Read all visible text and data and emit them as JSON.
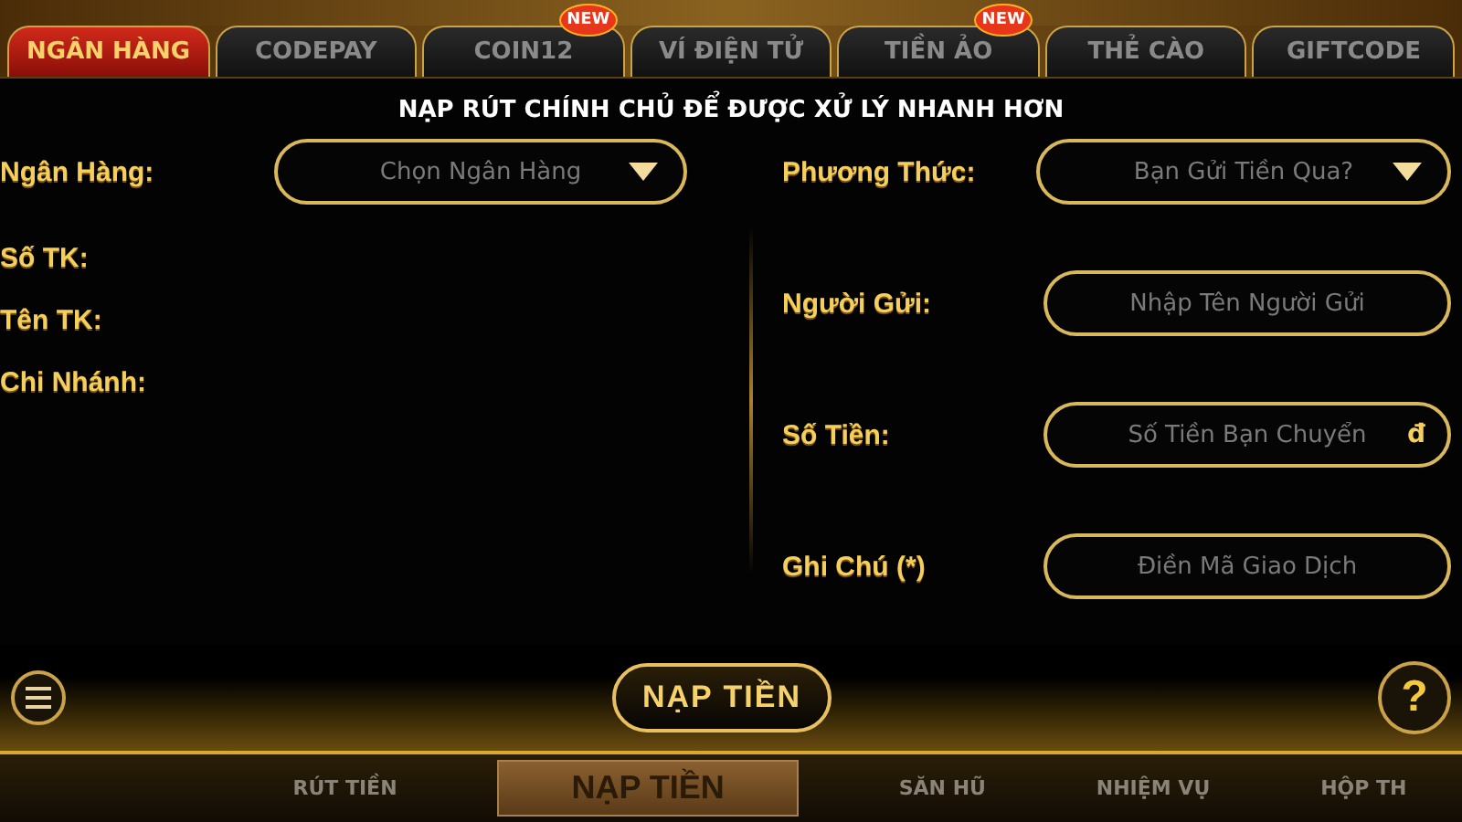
{
  "tabs": [
    {
      "label": "NGÂN HÀNG",
      "selected": true
    },
    {
      "label": "CODEPAY",
      "selected": false
    },
    {
      "label": "COIN12",
      "selected": false,
      "badge": "NEW"
    },
    {
      "label": "VÍ ĐIỆN TỬ",
      "selected": false
    },
    {
      "label": "TIỀN ẢO",
      "selected": false,
      "badge": "NEW"
    },
    {
      "label": "THẺ CÀO",
      "selected": false
    },
    {
      "label": "GIFTCODE",
      "selected": false
    }
  ],
  "heading": "NẠP RÚT CHÍNH CHỦ ĐỂ ĐƯỢC XỬ LÝ NHANH HƠN",
  "bank_info": [
    {
      "label": "Ngân Hàng:",
      "kind": "select",
      "placeholder": "Chọn Ngân Hàng"
    },
    {
      "label": "Số TK:",
      "kind": "info"
    },
    {
      "label": "Tên TK:",
      "kind": "info"
    },
    {
      "label": "Chi Nhánh:",
      "kind": "info"
    }
  ],
  "transfer_form": [
    {
      "label": "Phương Thức:",
      "kind": "select",
      "placeholder": "Bạn Gửi Tiền Qua?"
    },
    {
      "label": "Người Gửi:",
      "kind": "input",
      "placeholder": "Nhập Tên Người Gửi"
    },
    {
      "label": "Số Tiền:",
      "kind": "input",
      "placeholder": "Số Tiền Bạn Chuyển",
      "suffix": "đ"
    },
    {
      "label": "Ghi Chú (*)",
      "kind": "input",
      "placeholder": "Điền Mã Giao Dịch"
    }
  ],
  "submit_button": "NẠP TIỀN",
  "help_button": "?",
  "bottom_nav": [
    {
      "label": "RÚT TIỀN",
      "kind": "item"
    },
    {
      "label": "NẠP TIỀN",
      "kind": "center"
    },
    {
      "label": "SĂN HŨ",
      "kind": "item"
    },
    {
      "label": "NHIỆM VỤ",
      "kind": "item"
    },
    {
      "label": "HỘP TH",
      "kind": "item"
    }
  ]
}
